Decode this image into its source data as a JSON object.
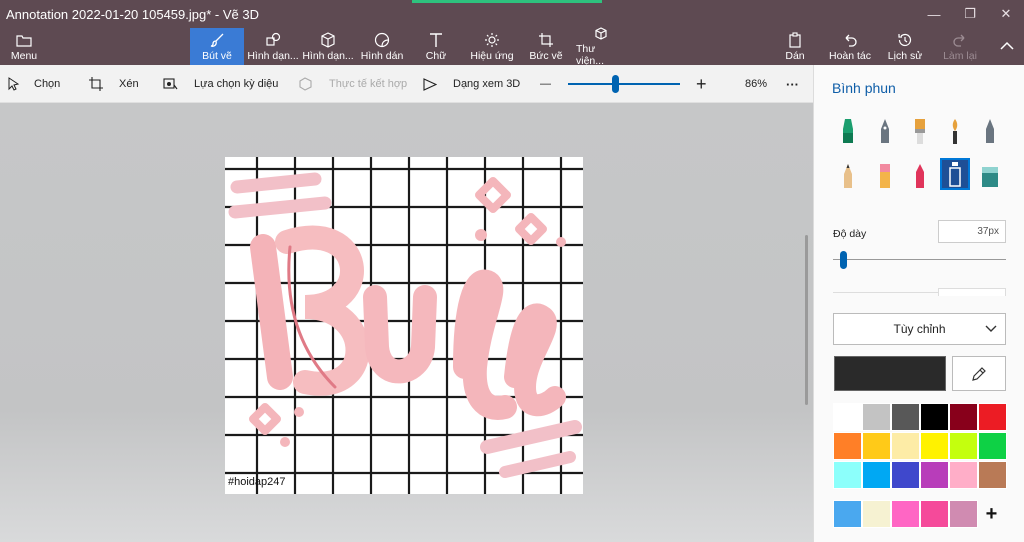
{
  "window": {
    "title": "Annotation 2022-01-20 105459.jpg* - Vẽ 3D",
    "minimize": "—",
    "restore": "❐",
    "close": "✕"
  },
  "ribbon": {
    "menu": "Menu",
    "tabs": [
      "Bút vẽ",
      "Hình dạn...",
      "Hình dạn...",
      "Hình dán",
      "Chữ",
      "Hiệu ứng",
      "Bức vẽ",
      "Thư viện..."
    ],
    "active_tab": 0,
    "right": {
      "paste": "Dán",
      "undo": "Hoàn tác",
      "history": "Lịch sử",
      "redo": "Làm lại"
    }
  },
  "toolbar": {
    "select": "Chọn",
    "crop": "Xén",
    "magic_select": "Lựa chọn kỳ diệu",
    "mixed_reality": "Thực tế kết hợp",
    "view_3d": "Dạng xem 3D",
    "zoom_minus": "—",
    "zoom_plus": "+",
    "zoom": "86%",
    "more": "···"
  },
  "canvas": {
    "watermark": "#hoidap247"
  },
  "panel": {
    "title": "Bình phun",
    "brushes": [
      "marker",
      "calligraphy-pen",
      "oil-brush",
      "watercolor",
      "pixel-pen",
      "pencil",
      "eraser",
      "crayon",
      "spray-can",
      "fill"
    ],
    "selected_brush": 8,
    "thickness_label": "Độ dày",
    "thickness_value": "37px",
    "thickness_level": 0.04,
    "dropdown": "Tùy chỉnh",
    "current_color": "#2a2a2a",
    "palette": [
      "#ffffff",
      "#c3c3c3",
      "#585858",
      "#000000",
      "#88001b",
      "#ec1c24",
      "#ff7f27",
      "#ffca18",
      "#fdeca6",
      "#fff200",
      "#c4ff0e",
      "#0ed145",
      "#8cfffb",
      "#00a8f3",
      "#3f48cc",
      "#b83dba",
      "#ffaec8",
      "#b97a56",
      "#4aa8ef",
      "#f6f2d2",
      "#ff66c4",
      "#f54a9a",
      "#d08bb1"
    ],
    "add_color": "+"
  }
}
